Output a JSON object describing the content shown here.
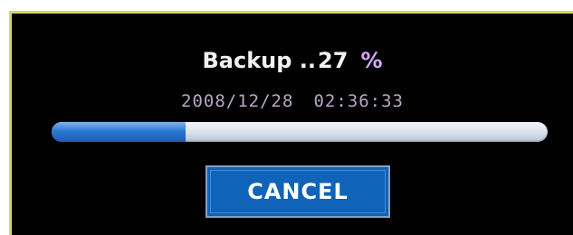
{
  "dialog": {
    "title_prefix": "Backup ..",
    "progress_value": "27",
    "progress_unit": "%",
    "progress_fraction": 0.27,
    "date": "2008/12/28",
    "time": "02:36:33",
    "cancel_label": "CANCEL"
  },
  "colors": {
    "background": "#000000",
    "border": "#d9d85a",
    "progress_fill": "#2b79d4",
    "progress_track": "#dce5ee",
    "button": "#0f63b8",
    "timestamp": "#b6a7c6"
  }
}
